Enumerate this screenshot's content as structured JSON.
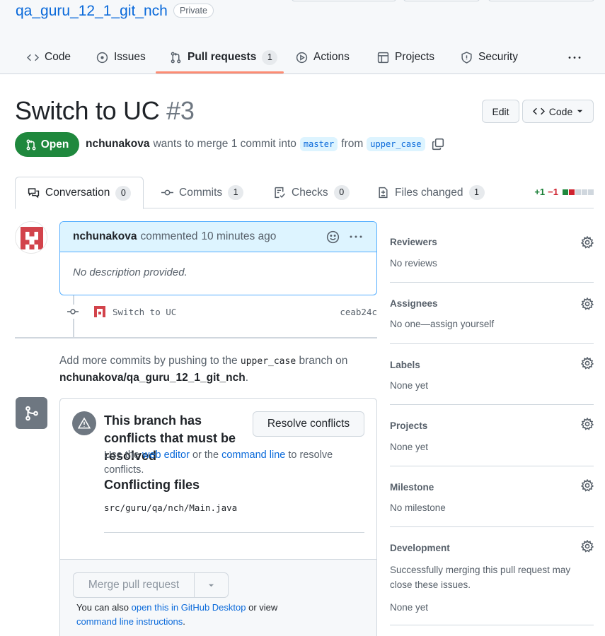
{
  "repo": {
    "name": "qa_guru_12_1_git_nch",
    "visibility": "Private"
  },
  "repo_nav": [
    {
      "label": "Code",
      "icon": "code-icon"
    },
    {
      "label": "Issues",
      "icon": "issue-icon"
    },
    {
      "label": "Pull requests",
      "icon": "git-pull-request-icon",
      "count": "1",
      "active": true
    },
    {
      "label": "Actions",
      "icon": "play-icon"
    },
    {
      "label": "Projects",
      "icon": "table-icon"
    },
    {
      "label": "Security",
      "icon": "shield-icon"
    }
  ],
  "pr": {
    "title": "Switch to UC",
    "number": "#3",
    "edit_label": "Edit",
    "code_label": "Code",
    "state": "Open",
    "author": "nchunakova",
    "merge_text": "wants to merge 1 commit into",
    "base_branch": "master",
    "from_text": "from",
    "head_branch": "upper_case"
  },
  "pr_tabs": [
    {
      "label": "Conversation",
      "count": "0",
      "icon": "comment-discussion-icon",
      "active": true
    },
    {
      "label": "Commits",
      "count": "1",
      "icon": "git-commit-icon"
    },
    {
      "label": "Checks",
      "count": "0",
      "icon": "checklist-icon"
    },
    {
      "label": "Files changed",
      "count": "1",
      "icon": "file-diff-icon"
    }
  ],
  "diffstat": {
    "additions": "+1",
    "deletions": "−1"
  },
  "comment": {
    "author": "nchunakova",
    "action": "commented",
    "time": "10 minutes ago",
    "body": "No description provided."
  },
  "commit": {
    "message": "Switch to UC",
    "sha": "ceab24c"
  },
  "add_more": {
    "text_before": "Add more commits by pushing to the",
    "branch": "upper_case",
    "text_mid": "branch on",
    "repo_full": "nchunakova/qa_guru_12_1_git_nch",
    "text_after": "."
  },
  "merge": {
    "conflict_title": "This branch has conflicts that must be resolved",
    "resolve_label": "Resolve conflicts",
    "desc_use": "Use the",
    "web_editor": "web editor",
    "desc_or": "or the",
    "command_line": "command line",
    "desc_rest": "to resolve conflicts.",
    "conflicting_files_title": "Conflicting files",
    "file": "src/guru/qa/nch/Main.java",
    "merge_label": "Merge pull request",
    "note_prefix": "You can also",
    "note_link": "open this in GitHub Desktop",
    "note_mid": "or view",
    "note_link2": "command line instructions",
    "note_end": "."
  },
  "sidebar": {
    "reviewers": {
      "heading": "Reviewers",
      "value": "No reviews"
    },
    "assignees": {
      "heading": "Assignees",
      "value": "No one—assign yourself"
    },
    "labels": {
      "heading": "Labels",
      "value": "None yet"
    },
    "projects": {
      "heading": "Projects",
      "value": "None yet"
    },
    "milestone": {
      "heading": "Milestone",
      "value": "No milestone"
    },
    "development": {
      "heading": "Development",
      "value": "Successfully merging this pull request may close these issues.",
      "value2": "None yet"
    }
  },
  "colors": {
    "accent": "#0969da",
    "open": "#1f883d",
    "tab_underline": "#fd8c73"
  }
}
